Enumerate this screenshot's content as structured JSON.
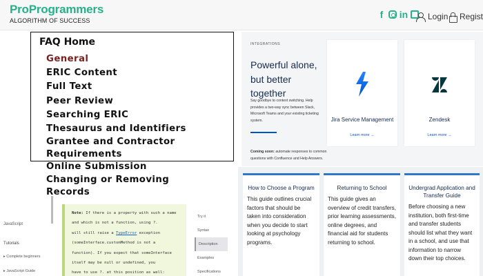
{
  "header": {
    "logo": "ProProgrammers",
    "tagline": "ALGORITHM OF SUCCESS",
    "social_icons": [
      "facebook-icon",
      "instagram-icon",
      "linkedin-icon",
      "mail-icon"
    ],
    "login_label": "Login",
    "register_label": "Register",
    "brand_color": "#27b089"
  },
  "faq": {
    "title": "FAQ Home",
    "items": [
      "General",
      "ERIC Content",
      "Full Text",
      "Peer Review",
      "Searching ERIC",
      "Thesaurus and Identifiers",
      "Grantee and Contractor Requirements",
      "Online Submission",
      "Changing or Removing Records"
    ],
    "active_item_color": "#7a1e1e"
  },
  "doc": {
    "sidebar_title": "JavaScript",
    "tutorials": "Tutorials",
    "complete_beginners": "▸ Complete beginners",
    "js_guide": "▸ JavaScript Guide",
    "note_line1_bold": "Note:",
    "note_line1": " If there is a property with such a name and which is not a function, using ?.",
    "note_line2a": "will still raise a ",
    "note_line2_link": "TypeError",
    "note_line2b": " exception (someInterface.customMethod is not a",
    "note_line3": "function). If you expect that someInterface itself may be null or undefined, you",
    "note_line4": "have to use ?. at this position as well: someInterface?.customMethod?.()",
    "nav": [
      "Try it",
      "Syntax",
      "Description",
      "Examples",
      "Specifications"
    ],
    "nav_selected_index": 2
  },
  "integrations": {
    "kicker": "INTEGRATIONS",
    "title": "Powerful alone, but better together",
    "description": "Say goodbye to context switching. Help provides a two-way sync between Slack, Microsoft Teams and your existing ticketing system.",
    "coming_soon_bold": "Coming soon:",
    "coming_soon": " automate responses to common questions with Confluence and Help Answers.",
    "cards": [
      {
        "name": "Jira Service Management",
        "link": "Learn more →",
        "icon": "jira-icon"
      },
      {
        "name": "Zendesk",
        "link": "Learn more →",
        "icon": "zendesk-icon"
      }
    ]
  },
  "guides": [
    {
      "title": "How to Choose a Program",
      "body": "This guide outlines crucial factors that should be taken into consideration when you decide to start looking at psychology programs."
    },
    {
      "title": "Returning to School",
      "body": "This guide gives an overview of credit transfers, prior learning assessments, online degrees, and financial aid for students returning to school."
    },
    {
      "title": "Undergrad Application and Transfer Guide",
      "body": "Before choosing a new institution, both first-time and transfer students should list what they want in a school, and use that information to narrow down their top choices."
    }
  ]
}
